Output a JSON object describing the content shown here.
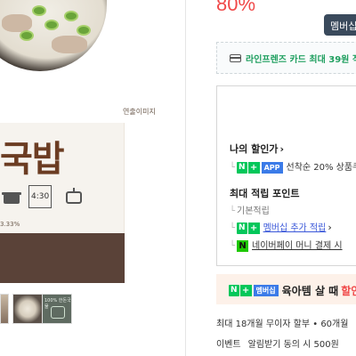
{
  "product_image": {
    "ambient_label": "연출이미지",
    "title": "국밥",
    "note": "3.33%",
    "icons": [
      "pot-icon",
      "timer-icon",
      "stove-icon"
    ],
    "icon_text": "4:30"
  },
  "thumbnails": [
    {
      "name": "thumbnail-1"
    },
    {
      "name": "thumbnail-2"
    },
    {
      "name": "thumbnail-3",
      "caption": "100% 한돈국물"
    }
  ],
  "price": {
    "discount_rate": "80%"
  },
  "member_button": {
    "label": "멤버십"
  },
  "card_banner": {
    "text": "라인프렌즈 카드 최대 39원 적립"
  },
  "benefits": {
    "my_discount_label": "나의 할인가",
    "app_badge_n": "N",
    "app_badge_plus": "+",
    "app_badge": "APP",
    "app_text": "선착순 20% 상품쿠폰",
    "max_points_label": "최대 적립 포인트",
    "basic_label": "기본적립",
    "member_n": "N",
    "member_plus": "+",
    "member_link": "멤버십 추가 적립",
    "npay_badge": "N",
    "npay_link": "네이버페이 머니 결제 시"
  },
  "promo": {
    "n": "N",
    "plus": "+",
    "membership": "멤버십",
    "text": "육아템 살 때",
    "accent": "할인"
  },
  "info": {
    "line1": "최대 18개월 무이자 할부 • 60개월",
    "event_label": "이벤트",
    "line2": "알림받기 동의 시 500원"
  },
  "colors": {
    "discount": "#f04a4a",
    "naver_green": "#03c75a",
    "card_green": "#1f9f5f",
    "link_blue": "#3b58d9",
    "member_btn": "#3a4a5c"
  }
}
